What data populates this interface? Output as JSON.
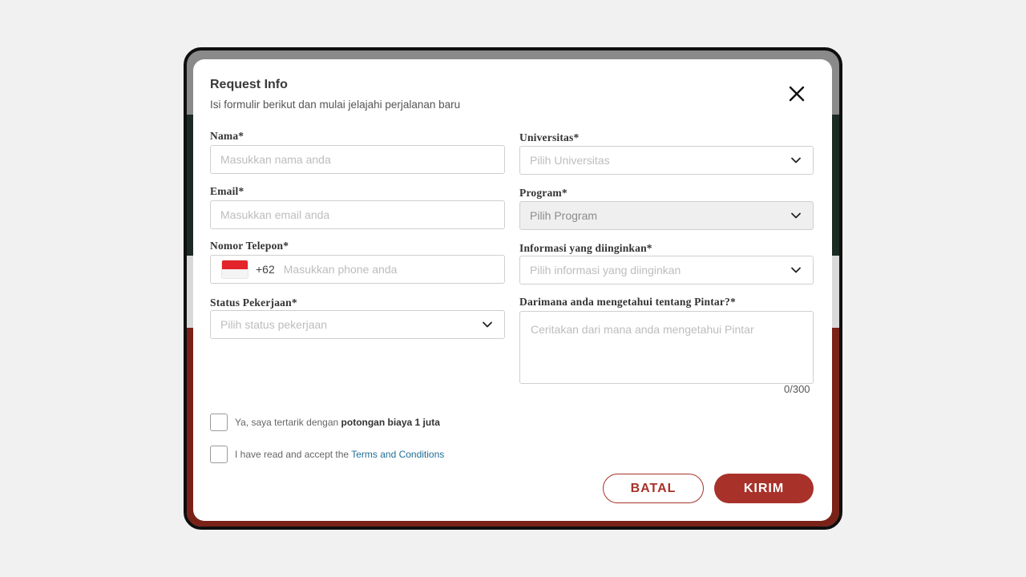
{
  "modal": {
    "title": "Request Info",
    "subtitle": "Isi formulir berikut dan mulai jelajahi perjalanan baru"
  },
  "form": {
    "nama": {
      "label": "Nama*",
      "placeholder": "Masukkan nama anda"
    },
    "email": {
      "label": "Email*",
      "placeholder": "Masukkan email anda"
    },
    "telepon": {
      "label": "Nomor Telepon*",
      "dial_code": "+62",
      "placeholder": "Masukkan phone anda"
    },
    "status": {
      "label": "Status Pekerjaan*",
      "placeholder": "Pilih status pekerjaan"
    },
    "universitas": {
      "label": "Universitas*",
      "placeholder": "Pilih Universitas"
    },
    "program": {
      "label": "Program*",
      "placeholder": "Pilih Program"
    },
    "informasi": {
      "label": "Informasi yang diinginkan*",
      "placeholder": "Pilih informasi yang diinginkan"
    },
    "darimana": {
      "label": "Darimana anda mengetahui tentang Pintar?*",
      "placeholder": "Ceritakan dari mana anda mengetahui Pintar",
      "counter": "0/300"
    }
  },
  "checks": {
    "discount": {
      "prefix": "Ya, saya tertarik dengan ",
      "bold": "potongan biaya 1 juta"
    },
    "terms": {
      "prefix": "I have read and accept the ",
      "link": "Terms and Conditions"
    }
  },
  "buttons": {
    "cancel": "BATAL",
    "submit": "KIRIM"
  },
  "colors": {
    "accent": "#a8322a",
    "link": "#1f6f95",
    "flag_red": "#e3242b"
  },
  "icons": {
    "close": "close-icon",
    "chevron": "chevron-down-icon",
    "flag": "indonesia-flag-icon"
  }
}
